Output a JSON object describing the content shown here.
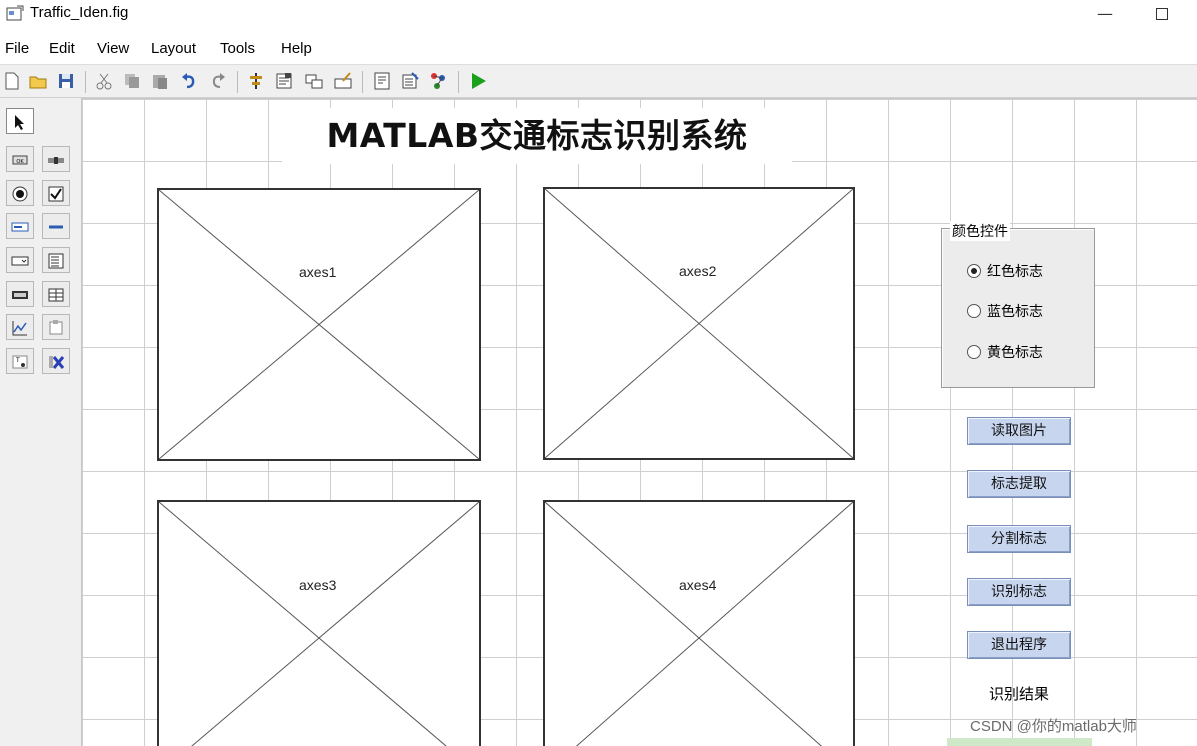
{
  "window": {
    "title": "Traffic_Iden.fig",
    "minimize_glyph": "—",
    "icon": "guide-figure-icon"
  },
  "menu": {
    "items": [
      {
        "label": "File"
      },
      {
        "label": "Edit"
      },
      {
        "label": "View"
      },
      {
        "label": "Layout"
      },
      {
        "label": "Tools"
      },
      {
        "label": "Help"
      }
    ]
  },
  "toolbar": {
    "icons": [
      "new-file-icon",
      "open-folder-icon",
      "save-icon",
      "cut-icon",
      "copy-icon",
      "paste-icon",
      "undo-icon",
      "redo-icon",
      "align-icon",
      "menu-editor-icon",
      "tab-order-icon",
      "toolbar-editor-icon",
      "editor-icon",
      "property-inspector-icon",
      "object-browser-icon",
      "run-icon"
    ]
  },
  "palette": {
    "tools": [
      "select-tool-icon",
      "push-button-icon",
      "slider-icon",
      "radio-button-icon",
      "checkbox-icon",
      "edit-text-icon",
      "static-text-icon",
      "popup-menu-icon",
      "listbox-icon",
      "toggle-button-icon",
      "table-icon",
      "axes-icon",
      "panel-icon",
      "button-group-icon",
      "activex-icon"
    ]
  },
  "figure": {
    "title": "MATLAB交通标志识别系统",
    "axes": [
      {
        "label": "axes1"
      },
      {
        "label": "axes2"
      },
      {
        "label": "axes3"
      },
      {
        "label": "axes4"
      }
    ],
    "button_group": {
      "title": "颜色控件",
      "options": [
        {
          "label": "红色标志",
          "selected": true
        },
        {
          "label": "蓝色标志",
          "selected": false
        },
        {
          "label": "黄色标志",
          "selected": false
        }
      ]
    },
    "buttons": [
      {
        "label": "读取图片"
      },
      {
        "label": "标志提取"
      },
      {
        "label": "分割标志"
      },
      {
        "label": "识别标志"
      },
      {
        "label": "退出程序"
      }
    ],
    "result_label": "识别结果"
  },
  "watermark": "CSDN @你的matlab大师",
  "colors": {
    "button_face": "#c7d5ee",
    "grid": "#cfcfcf",
    "run_green": "#1aa01a"
  }
}
